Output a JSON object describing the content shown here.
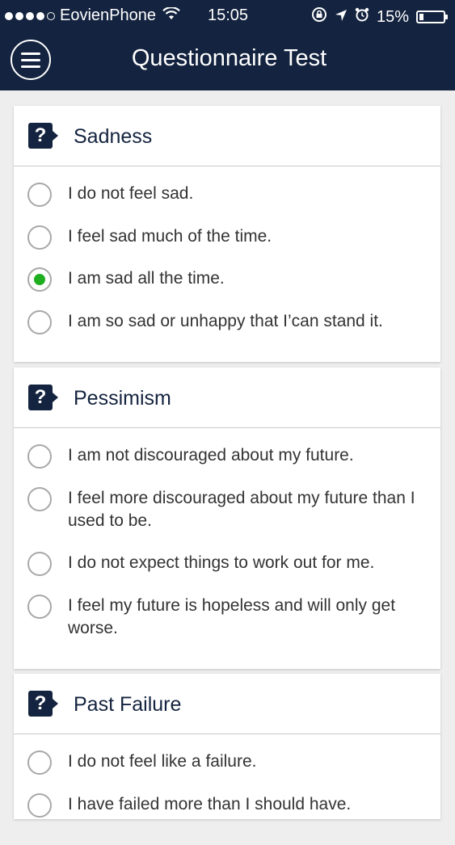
{
  "status_bar": {
    "carrier": "EovienPhone",
    "time": "15:05",
    "battery_percent": "15%",
    "battery_level": 0.15,
    "signal_bars_filled": 4
  },
  "nav": {
    "title": "Questionnaire Test",
    "menu_icon": "hamburger-menu-icon",
    "bar_color": "#14233f"
  },
  "colors": {
    "accent": "#14233f",
    "selected": "#1fae1f",
    "background": "#eeeeee"
  },
  "questions": [
    {
      "title": "Sadness",
      "options": [
        "I do not feel sad.",
        "I feel sad much of the time.",
        "I am sad all the time.",
        "I am so sad or unhappy that I’can stand it."
      ],
      "selected_index": 2
    },
    {
      "title": "Pessimism",
      "options": [
        "I am not discouraged about my future.",
        "I feel more discouraged about my future than I used to be.",
        "I do not expect things to work out for me.",
        "I feel my future is hopeless and will only get worse."
      ],
      "selected_index": null
    },
    {
      "title": "Past Failure",
      "options": [
        "I do not feel like a failure.",
        "I have failed more than I should have."
      ],
      "selected_index": null
    }
  ]
}
